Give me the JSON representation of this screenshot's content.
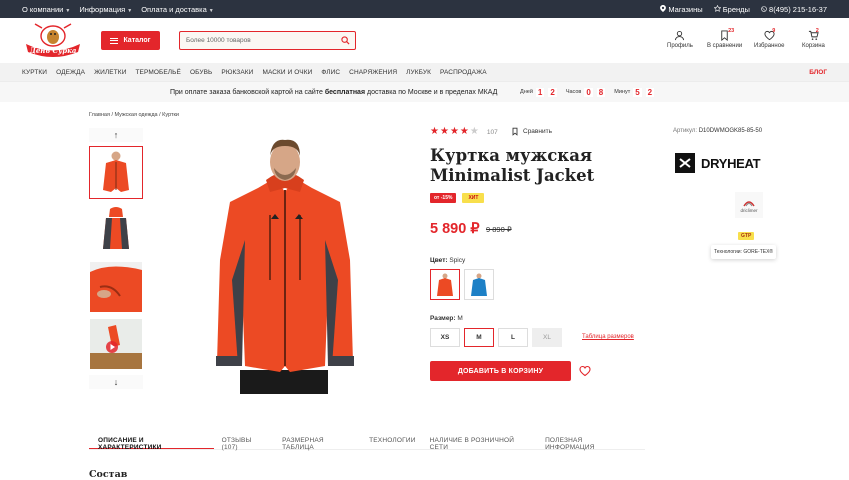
{
  "topbar": {
    "left_links": [
      "О компании",
      "Информация",
      "Оплата и доставка"
    ],
    "shops": "Магазины",
    "brands": "Бренды",
    "phone": "8(495) 215-16-37"
  },
  "header": {
    "logo_text": "День Сурка",
    "catalog_label": "Каталог",
    "search_placeholder": "Более 10000 товаров",
    "icons": [
      {
        "name": "profile",
        "label": "Профиль",
        "count": ""
      },
      {
        "name": "compare",
        "label": "В сравнении",
        "count": "23"
      },
      {
        "name": "favorites",
        "label": "Избранное",
        "count": "9"
      },
      {
        "name": "cart",
        "label": "Корзина",
        "count": "2"
      }
    ]
  },
  "nav": {
    "items": [
      "КУРТКИ",
      "ОДЕЖДА",
      "ЖИЛЕТКИ",
      "ТЕРМОБЕЛЬЁ",
      "ОБУВЬ",
      "РЮКЗАКИ",
      "МАСКИ И ОЧКИ",
      "ФЛИС",
      "СНАРЯЖЕНИЯ",
      "ЛУКБУК",
      "РАСПРОДАЖА"
    ],
    "blog": "БЛОГ"
  },
  "promo": {
    "text_before": "При оплате заказа банковской картой на сайте ",
    "text_bold": "бесплатная",
    "text_after": " доставка по Москве и в пределах МКАД",
    "days_label": "Дней",
    "days": [
      "1",
      "2"
    ],
    "hours_label": "Часов",
    "hours": [
      "0",
      "8"
    ],
    "minutes_label": "Минут",
    "minutes": [
      "5",
      "2"
    ]
  },
  "breadcrumb": "Главная  /  Мужская одежда / Куртки",
  "product": {
    "rating": 4,
    "reviews_count": "107",
    "compare_label": "Сравнить",
    "article_label": "Артикул:",
    "article_value": "D10DWMOGK85-85-50",
    "title_line1": "Куртка мужская",
    "title_line2": "Minimalist Jacket",
    "badge_sale": "от -15%",
    "badge_hit": "ХИТ",
    "price": "5 890 ₽",
    "old_price": "9 890 ₽",
    "color_label": "Цвет:",
    "color_value": "Spicy",
    "size_label": "Размер:",
    "size_value": "M",
    "sizes": [
      {
        "label": "XS",
        "state": "normal"
      },
      {
        "label": "M",
        "state": "active"
      },
      {
        "label": "L",
        "state": "normal"
      },
      {
        "label": "XL",
        "state": "disabled"
      }
    ],
    "size_table": "Таблица размеров",
    "add_to_cart": "ДОБАВИТЬ В КОРЗИНУ",
    "brand_name": "DRYHEAT",
    "dricl_label": "driclimer",
    "gtp_badge": "GTP",
    "tech_tooltip": "Технологии: GORE-TEX®",
    "accent_color": "#e3262b",
    "jacket_color": "#ec4a24",
    "alt_color": "#1d80c6"
  },
  "tabs": [
    "ОПИСАНИЕ И ХАРАКТЕРИСТИКИ",
    "ОТЗЫВЫ (107)",
    "РАЗМЕРНАЯ ТАБЛИЦА",
    "ТЕХНОЛОГИИ",
    "НАЛИЧИЕ В РОЗНИЧНОЙ СЕТИ",
    "ПОЛЕЗНАЯ ИНФОРМАЦИЯ"
  ],
  "section_title": "Состав"
}
